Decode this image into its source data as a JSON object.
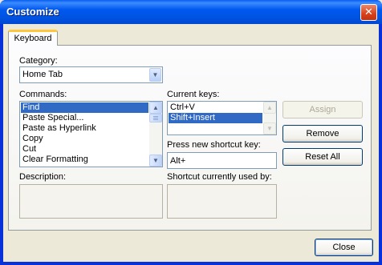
{
  "window": {
    "title": "Customize",
    "close_glyph": "✕"
  },
  "tabs": [
    {
      "label": "Keyboard"
    }
  ],
  "category": {
    "label": "Category:",
    "value": "Home Tab"
  },
  "commands": {
    "label": "Commands:",
    "items": [
      "Find",
      "Paste Special...",
      "Paste as Hyperlink",
      "Copy",
      "Cut",
      "Clear Formatting"
    ],
    "selected_index": 0
  },
  "current_keys": {
    "label": "Current keys:",
    "items": [
      "Ctrl+V",
      "Shift+Insert"
    ],
    "selected_index": 1
  },
  "new_shortcut": {
    "label": "Press new shortcut key:",
    "value": "Alt+"
  },
  "description": {
    "label": "Description:"
  },
  "used_by": {
    "label": "Shortcut currently used by:"
  },
  "buttons": {
    "assign": "Assign",
    "remove": "Remove",
    "reset_all": "Reset All",
    "close": "Close"
  },
  "icons": {
    "dropdown": "chevron-down-icon",
    "scroll_up": "scroll-up-icon",
    "scroll_down": "scroll-down-icon",
    "close": "close-icon"
  },
  "colors": {
    "title_bar": "#0054e3",
    "selection": "#316ac5",
    "tab_highlight": "#ffc83c",
    "close_button": "#d8401a"
  }
}
